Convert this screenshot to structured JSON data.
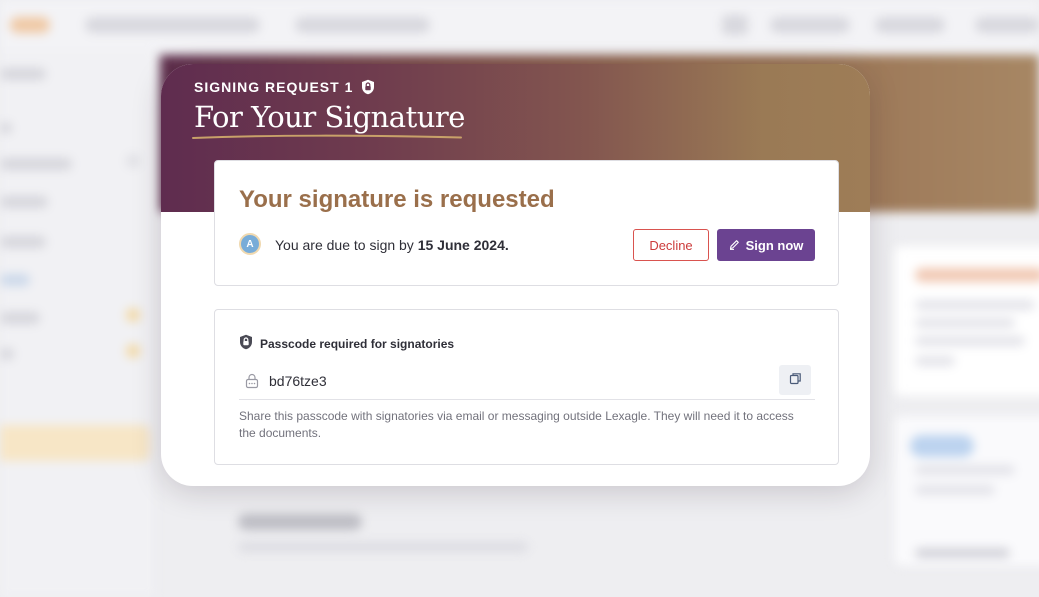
{
  "header": {
    "eyebrow": "SIGNING REQUEST 1",
    "title": "For Your Signature"
  },
  "signature_card": {
    "heading": "Your signature is requested",
    "avatar_initial": "A",
    "due_prefix": "You are due to sign by ",
    "due_date": "15 June 2024.",
    "decline_label": "Decline",
    "sign_label": "Sign now"
  },
  "passcode_card": {
    "title": "Passcode required for signatories",
    "value": "bd76tze3",
    "help": "Share this passcode with signatories via email or messaging outside Lexagle. They will need it to access the documents."
  },
  "colors": {
    "accent_purple": "#6b4391",
    "heading_brown": "#9a6f4b",
    "decline_red": "#cc3b3b",
    "header_gradient_start": "#5f2c4f",
    "header_gradient_end": "#9e7d57"
  },
  "icons": {
    "eyebrow": "shield-lock-icon",
    "sign": "pen-icon",
    "passcode_title": "shield-lock-icon",
    "passcode_field": "padlock-icon",
    "copy": "copy-icon"
  }
}
